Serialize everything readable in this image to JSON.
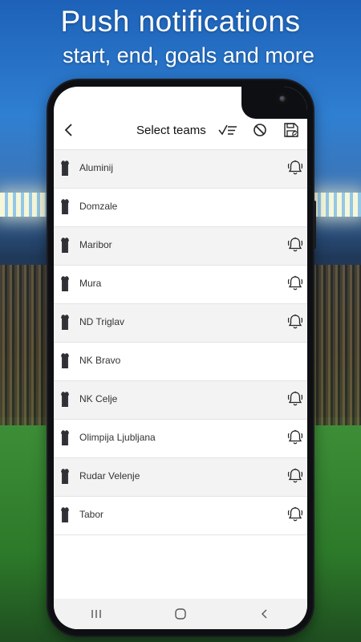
{
  "promo": {
    "headline": "Push notifications",
    "subheadline": "start, end, goals and more"
  },
  "toolbar": {
    "title": "Select teams",
    "icons": [
      "back-icon",
      "select-all-icon",
      "block-icon",
      "save-icon"
    ]
  },
  "teams": [
    {
      "name": "Aluminij",
      "notifications": true
    },
    {
      "name": "Domzale",
      "notifications": false
    },
    {
      "name": "Maribor",
      "notifications": true
    },
    {
      "name": "Mura",
      "notifications": true
    },
    {
      "name": "ND Triglav",
      "notifications": true
    },
    {
      "name": "NK Bravo",
      "notifications": false
    },
    {
      "name": "NK Celje",
      "notifications": true
    },
    {
      "name": "Olimpija Ljubljana",
      "notifications": true
    },
    {
      "name": "Rudar Velenje",
      "notifications": true
    },
    {
      "name": "Tabor",
      "notifications": true
    }
  ],
  "navbar": {
    "buttons": [
      "recent-apps-icon",
      "home-icon",
      "back-nav-icon"
    ]
  },
  "colors": {
    "row_shaded": "#f3f3f3",
    "row_border": "#e3e3e3",
    "jersey": "#2f3036",
    "icon": "#222222"
  }
}
